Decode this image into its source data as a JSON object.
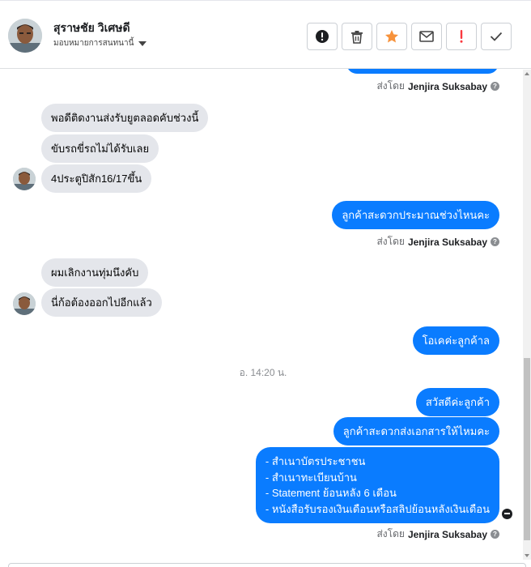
{
  "header": {
    "contact_name": "สุราษชัย วิเศษดี",
    "assigned_label": "มอบหมายการสนทนานี้",
    "actions": [
      {
        "name": "spam-button",
        "icon": "exclamation-circle-icon"
      },
      {
        "name": "delete-button",
        "icon": "trash-icon"
      },
      {
        "name": "star-button",
        "icon": "star-icon"
      },
      {
        "name": "mark-unread-button",
        "icon": "envelope-icon"
      },
      {
        "name": "follow-up-button",
        "icon": "exclamation-icon"
      },
      {
        "name": "mark-done-button",
        "icon": "checkmark-icon"
      }
    ]
  },
  "chat": {
    "sent_by_prefix": "ส่งโดย",
    "agent_name": "Jenjira Suksabay",
    "incoming_1": [
      "พอดีติดงานส่งรับยูตลอดคับช่วงนี้",
      "ขับรถขี่รถไม่ได้รับเลย",
      "4ประตูปิสัก16/17ขึ้น"
    ],
    "outgoing_1": "ลูกค้าสะดวกประมาณช่วงไหนคะ",
    "incoming_2": [
      "ผมเลิกงานทุ่มนึงคับ",
      "นี่ก้อต้องออกไปอีกแล้ว"
    ],
    "outgoing_2": "โอเคค่ะลูกค้าล",
    "timestamp": "อ. 14:20 น.",
    "outgoing_3": "สวัสดีค่ะลูกค้า",
    "outgoing_4": "ลูกค้าสะดวกส่งเอกสารให้ไหมคะ",
    "outgoing_list": [
      "- สำเนาบัตรประชาชน",
      "- สำเนาทะเบียนบ้าน",
      "- Statement ย้อนหลัง 6 เดือน",
      "- หนังสือรับรองเงินเดือนหรือสลิปย้อนหลังเงินเดือน"
    ]
  },
  "colors": {
    "outgoing_bubble": "#0a7cff",
    "incoming_bubble": "#e4e6eb",
    "star": "#f7923b",
    "follow_up": "#fa383e"
  }
}
